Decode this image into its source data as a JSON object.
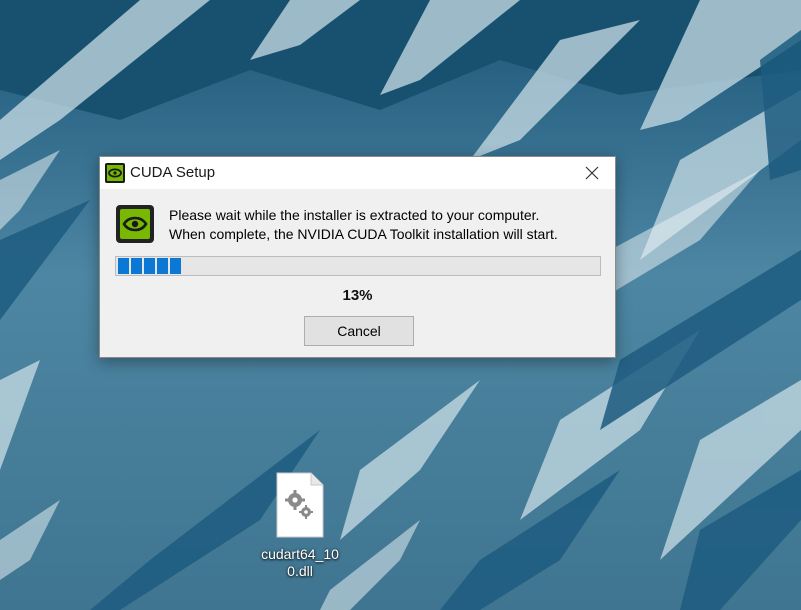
{
  "dialog": {
    "title": "CUDA Setup",
    "message_line1": "Please wait while the installer is extracted to your computer.",
    "message_line2": "When complete, the NVIDIA CUDA Toolkit installation will start.",
    "progress_percent_text": "13%",
    "progress_fraction": 0.13,
    "cancel_label": "Cancel",
    "close_icon": "close-icon",
    "app_icon": "nvidia-logo-icon"
  },
  "desktop": {
    "icons": [
      {
        "label": "cudart64_100.dll",
        "icon": "dll-file-icon"
      }
    ]
  },
  "colors": {
    "progress": "#0a78d4",
    "nvidia_green": "#76b900",
    "dialog_bg": "#f0f0f0"
  }
}
